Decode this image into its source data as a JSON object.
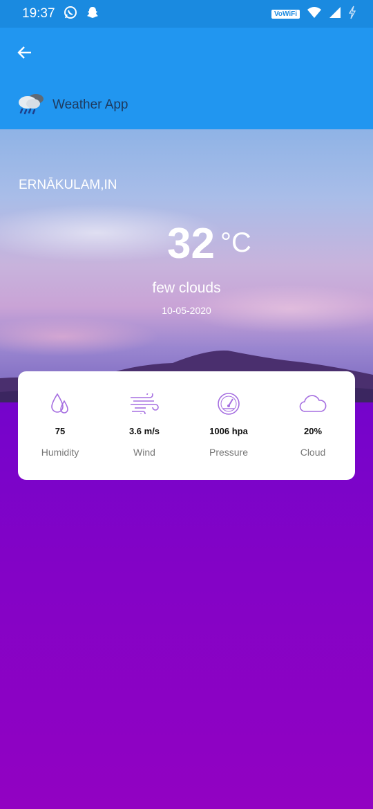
{
  "status_bar": {
    "time": "19:37",
    "wifi_label": "VoWiFi"
  },
  "app_bar": {
    "title": "Weather App"
  },
  "weather": {
    "city": "ERNĀKULAM,IN",
    "temperature": "32",
    "unit": "°C",
    "description": "few clouds",
    "date": "10-05-2020"
  },
  "details": [
    {
      "icon": "humidity-drop-icon",
      "value": "75",
      "label": "Humidity"
    },
    {
      "icon": "wind-icon",
      "value": "3.6 m/s",
      "label": "Wind"
    },
    {
      "icon": "pressure-gauge-icon",
      "value": "1006 hpa",
      "label": "Pressure"
    },
    {
      "icon": "cloud-icon",
      "value": "20%",
      "label": "Cloud"
    }
  ],
  "colors": {
    "status_bar": "#1a8ae0",
    "app_bar": "#2196f0",
    "icon_accent": "#a56ee0"
  }
}
